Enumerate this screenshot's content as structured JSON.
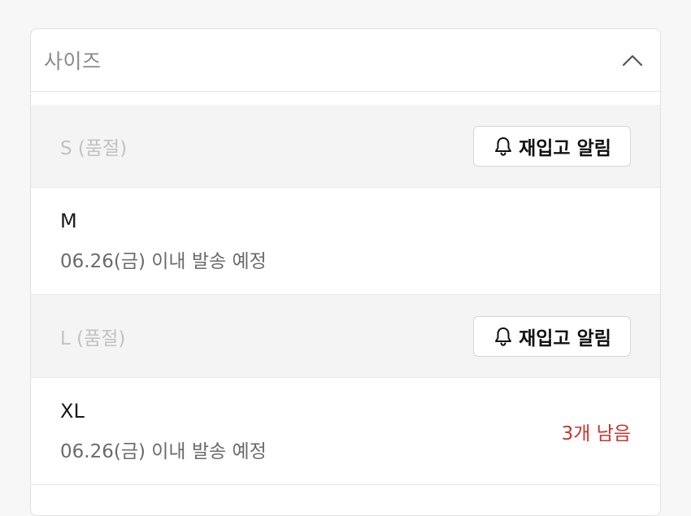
{
  "dropdown": {
    "title": "사이즈",
    "icon": "chevron-up-icon"
  },
  "options": [
    {
      "size_label": "S (품절)",
      "status": "soldout",
      "button_label": "재입고 알림"
    },
    {
      "size_label": "M",
      "status": "available",
      "shipping": "06.26(금) 이내 발송 예정"
    },
    {
      "size_label": "L (품절)",
      "status": "soldout",
      "button_label": "재입고 알림"
    },
    {
      "size_label": "XL",
      "status": "available",
      "shipping": "06.26(금) 이내 발송 예정",
      "stock_note": "3개 남음"
    }
  ],
  "colors": {
    "stock_warning": "#c8352f",
    "soldout_text": "#c2c2c2",
    "soldout_bg": "#f4f4f4"
  }
}
